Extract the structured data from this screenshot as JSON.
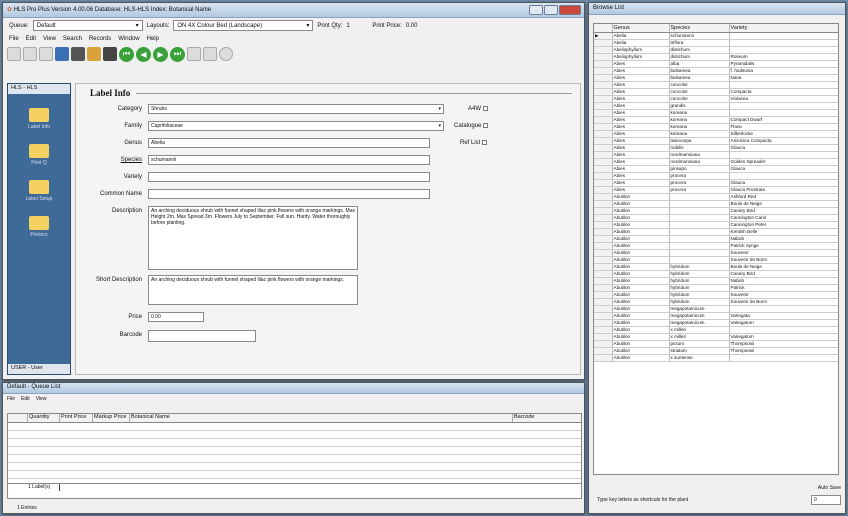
{
  "main": {
    "title": "HLS Pro Plus Version 4.00.06 Database: HLS-HLS Index: Botanical Name",
    "queue_label": "Queue:",
    "queue_value": "Default",
    "layouts_label": "Layouts:",
    "layouts_value": "ON 4X Colour Bed (Landscape)",
    "print_qty_label": "Print Qty:",
    "print_qty_value": "1",
    "print_price_label": "Print Price:",
    "print_price_value": "0.00",
    "menu": [
      "File",
      "Edit",
      "View",
      "Search",
      "Records",
      "Window",
      "Help"
    ],
    "side_tab": "HLS - HLS",
    "side_items": [
      "Label Info",
      "Print Q",
      "Label Setup",
      "Printers"
    ],
    "user": "USER - User",
    "group_title": "Label Info",
    "labels": {
      "category": "Category",
      "family": "Family",
      "genus": "Genus",
      "species": "Species",
      "variety": "Variety",
      "common": "Common Name",
      "description": "Description",
      "short_description": "Short Description",
      "price": "Price",
      "barcode": "Barcode",
      "a4w": "A4W",
      "catalogue": "Catalogue",
      "ref_list": "Ref List"
    },
    "values": {
      "category": "Shrubs",
      "family": "Caprifoliaceae",
      "genus": "Abelia",
      "species": "schumannii",
      "variety": "",
      "common": "",
      "description": "An arching deciduous shrub with funnel shaped lilac pink flowers with orange markings. Max Height 2m. Max Spread 3m. Flowers July to September. Full sun. Hardy. Water thoroughly before planting.",
      "short_description": "An arching deciduous shrub with funnel shaped lilac pink flowers with orange markings.",
      "price": "0.00",
      "barcode": ""
    }
  },
  "queue": {
    "title": "Default - Queue List",
    "menu": [
      "File",
      "Edit",
      "View"
    ],
    "columns": [
      "Quantity",
      "Print Price",
      "Markup Price",
      "Botanical Name",
      "Barcode"
    ],
    "footer": "1 Label(s)",
    "footer2": "1 Entries"
  },
  "browse": {
    "title": "Browse List",
    "columns": [
      "Genus",
      "Species",
      "Variety"
    ],
    "rows": [
      [
        "Abelia",
        "schumannii",
        ""
      ],
      [
        "Abelia",
        "triflora",
        ""
      ],
      [
        "Abeliophyllum",
        "distichum",
        ""
      ],
      [
        "Abeliophyllum",
        "distichum",
        "Roseum"
      ],
      [
        "Abies",
        "alba",
        "Pyramidalis"
      ],
      [
        "Abies",
        "balsamea",
        "f. hudsonia"
      ],
      [
        "Abies",
        "balsamea",
        "Nana"
      ],
      [
        "Abies",
        "concolor",
        ""
      ],
      [
        "Abies",
        "concolor",
        "Compacta"
      ],
      [
        "Abies",
        "concolor",
        "Violacea"
      ],
      [
        "Abies",
        "grandis",
        ""
      ],
      [
        "Abies",
        "koreana",
        ""
      ],
      [
        "Abies",
        "koreana",
        "Compact Dwarf"
      ],
      [
        "Abies",
        "koreana",
        "Flava"
      ],
      [
        "Abies",
        "koreana",
        "Silberlocke"
      ],
      [
        "Abies",
        "lasiocarpa",
        "Arizonica Compacta"
      ],
      [
        "Abies",
        "nobilis",
        "Glauca"
      ],
      [
        "Abies",
        "nordmanniana",
        ""
      ],
      [
        "Abies",
        "nordmanniana",
        "Golden Spreader"
      ],
      [
        "Abies",
        "pinsapo",
        "Glauca"
      ],
      [
        "Abies",
        "procera",
        ""
      ],
      [
        "Abies",
        "procera",
        "Glauca"
      ],
      [
        "Abies",
        "procera",
        "Glauca Prostrata"
      ],
      [
        "Abutilon",
        "",
        "Ashford Red"
      ],
      [
        "Abutilon",
        "",
        "Boule de Neige"
      ],
      [
        "Abutilon",
        "",
        "Canary Bird"
      ],
      [
        "Abutilon",
        "",
        "Cannington Carol"
      ],
      [
        "Abutilon",
        "",
        "Cannington Peter"
      ],
      [
        "Abutilon",
        "",
        "Kentish Belle"
      ],
      [
        "Abutilon",
        "",
        "Nabob"
      ],
      [
        "Abutilon",
        "",
        "Patrick Synge"
      ],
      [
        "Abutilon",
        "",
        "Souvenir"
      ],
      [
        "Abutilon",
        "",
        "Souvenir de Bonn"
      ],
      [
        "Abutilon",
        "hybridum",
        "Boule de Neige"
      ],
      [
        "Abutilon",
        "hybridum",
        "Canary Bird"
      ],
      [
        "Abutilon",
        "hybridum",
        "Nabob"
      ],
      [
        "Abutilon",
        "hybridum",
        "Patrick"
      ],
      [
        "Abutilon",
        "hybridum",
        "Souvenir"
      ],
      [
        "Abutilon",
        "hybridum",
        "Souvenir de Bonn"
      ],
      [
        "Abutilon",
        "megapotamicum",
        ""
      ],
      [
        "Abutilon",
        "megapotamicum",
        "Variegata"
      ],
      [
        "Abutilon",
        "megapotamicum",
        "Variegatum"
      ],
      [
        "Abutilon",
        "x milleri",
        ""
      ],
      [
        "Abutilon",
        "x milleri",
        "Variegatum"
      ],
      [
        "Abutilon",
        "pictum",
        "Thompsonii"
      ],
      [
        "Abutilon",
        "striatum",
        "Thompsonii"
      ],
      [
        "Abutilon",
        "x suntense",
        ""
      ]
    ],
    "hint": "Type key letters as shortcuts for the plant",
    "autosave_label": "Auto Save",
    "autosave_value": "0"
  }
}
